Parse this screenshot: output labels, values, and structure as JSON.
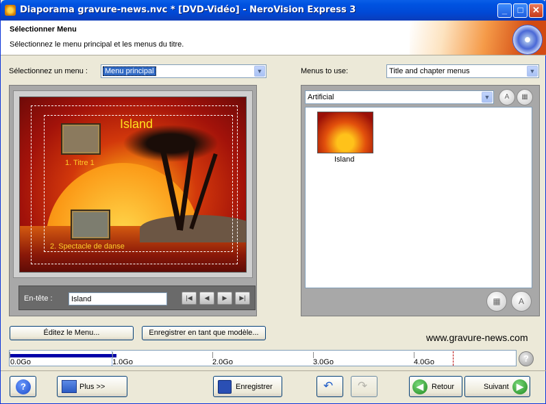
{
  "window": {
    "title": "Diaporama gravure-news.nvc * [DVD-Vidéo] - NeroVision Express 3",
    "minimize": "_",
    "maximize": "□",
    "close": "✕"
  },
  "header": {
    "title": "Sélectionner Menu",
    "subtitle": "Sélectionnez le menu principal et les menus du titre."
  },
  "left": {
    "select_label": "Sélectionnez un menu :",
    "select_value": "Menu principal",
    "preview": {
      "title": "Island",
      "button1": "1. Titre 1",
      "button2": "2. Spectacle de danse"
    },
    "header_label": "En-tête :",
    "header_value": "Island",
    "nav_icons": [
      "first-icon",
      "prev-icon",
      "next-icon",
      "last-icon"
    ]
  },
  "right": {
    "menus_label": "Menus to use:",
    "menus_value": "Title and chapter menus",
    "category_value": "Artificial",
    "template_name": "Island"
  },
  "actions": {
    "edit_menu": "Éditez le Menu...",
    "save_template": "Enregistrer en tant que modèle..."
  },
  "site": "www.gravure-news.com",
  "capacity": {
    "used_fraction": 0.21,
    "ticks": [
      "0.0Go",
      "1.0Go",
      "2.0Go",
      "3.0Go",
      "4.0Go"
    ]
  },
  "footer": {
    "more": "Plus >>",
    "save": "Enregistrer",
    "back": "Retour",
    "next": "Suivant"
  },
  "colors": {
    "titlebar": "#0053e1",
    "accent_green": "#2e9b2e",
    "capacity_fill": "#0000a8"
  }
}
